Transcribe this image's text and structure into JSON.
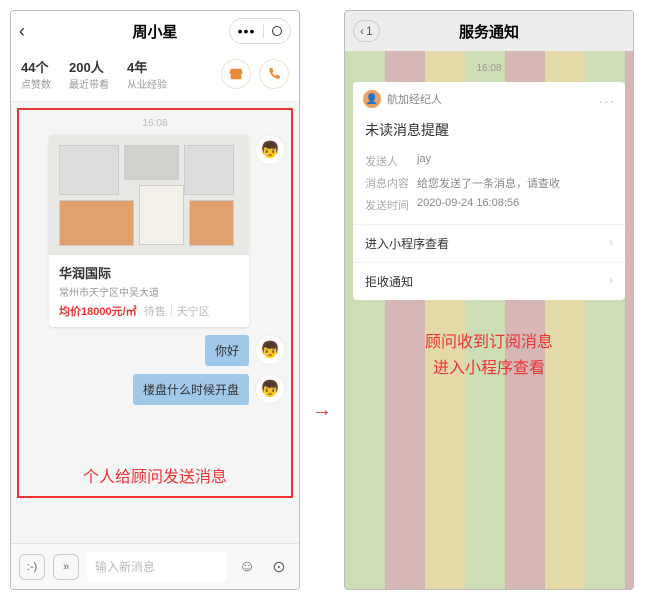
{
  "left": {
    "header": {
      "title": "周小星",
      "menu_dots": "•••"
    },
    "stats": [
      {
        "value": "44个",
        "label": "点赞数"
      },
      {
        "value": "200人",
        "label": "最近带看"
      },
      {
        "value": "4年",
        "label": "从业经验"
      }
    ],
    "buttons": {
      "store_icon": "▭",
      "call_icon": "call"
    },
    "timestamp": "16:08",
    "card": {
      "title": "华润国际",
      "address": "常州市天宁区中吴大道",
      "price": "均价18000元/㎡",
      "tags": "待售｜天宁区"
    },
    "messages": [
      {
        "text": "你好"
      },
      {
        "text": "楼盘什么时候开盘"
      }
    ],
    "caption": "个人给顾问发送消息",
    "inputbar": {
      "keyboard_icon": "⌨",
      "voice_icon": "❯❯",
      "placeholder": "输入新消息",
      "emoji_icon": "☺",
      "camera_icon": "◯"
    },
    "avatar_face": "👦"
  },
  "right": {
    "header": {
      "title": "服务通知",
      "back_count": "1"
    },
    "timestamp": "16:08",
    "notif": {
      "app_icon": "👤",
      "app_name": "航加经纪人",
      "dots": "...",
      "title": "未读消息提醒",
      "rows": [
        {
          "k": "发送人",
          "v": "jay"
        },
        {
          "k": "消息内容",
          "v": "给您发送了一条消息，请查收"
        },
        {
          "k": "发送时间",
          "v": "2020-09-24 16:08:56"
        }
      ],
      "actions": [
        {
          "label": "进入小程序查看"
        },
        {
          "label": "拒收通知"
        }
      ]
    },
    "caption_line1": "顾问收到订阅消息",
    "caption_line2": "进入小程序查看"
  },
  "arrow": "→"
}
